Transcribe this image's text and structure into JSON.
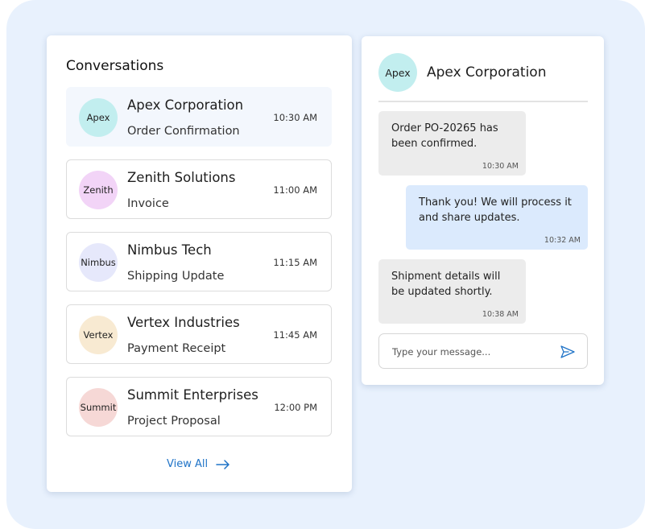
{
  "colors": {
    "accent": "#1f73c7",
    "active_item_bg": "#f3f7fd",
    "incoming_bubble": "#ececec",
    "outgoing_bubble": "#dbeafd"
  },
  "conversations": {
    "title": "Conversations",
    "items": [
      {
        "avatar": "Apex",
        "avatar_color": "#c2eeef",
        "name": "Apex Corporation",
        "subject": "Order Confirmation",
        "time": "10:30 AM",
        "active": true
      },
      {
        "avatar": "Zenith",
        "avatar_color": "#f2d4f7",
        "name": "Zenith Solutions",
        "subject": "Invoice",
        "time": "11:00 AM",
        "active": false
      },
      {
        "avatar": "Nimbus",
        "avatar_color": "#e6e8fb",
        "name": "Nimbus Tech",
        "subject": "Shipping Update",
        "time": "11:15 AM",
        "active": false
      },
      {
        "avatar": "Vertex",
        "avatar_color": "#f8ead2",
        "name": "Vertex Industries",
        "subject": "Payment Receipt",
        "time": "11:45 AM",
        "active": false
      },
      {
        "avatar": "Summit",
        "avatar_color": "#f6d8d6",
        "name": "Summit Enterprises",
        "subject": "Project Proposal",
        "time": "12:00 PM",
        "active": false
      }
    ],
    "view_all": "View All",
    "view_all_icon": "arrow-right-icon"
  },
  "chat": {
    "avatar": "Apex",
    "avatar_color": "#c2eeef",
    "name": "Apex Corporation",
    "messages": [
      {
        "direction": "incoming",
        "text": "Order PO-20265 has been confirmed.",
        "time": "10:30 AM"
      },
      {
        "direction": "outgoing",
        "text": "Thank you! We will process it and share updates.",
        "time": "10:32 AM"
      },
      {
        "direction": "incoming",
        "text": "Shipment details will be updated shortly.",
        "time": "10:38 AM"
      }
    ],
    "input": {
      "value": "",
      "placeholder": "Type your message..."
    },
    "send_icon": "send-icon"
  }
}
